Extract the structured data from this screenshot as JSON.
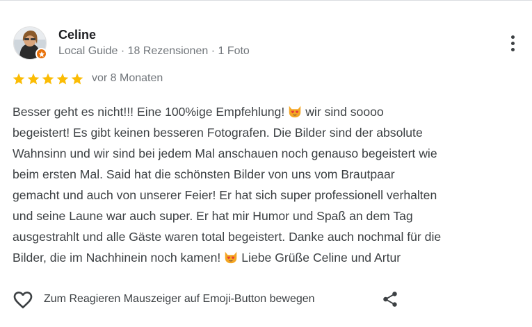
{
  "review": {
    "author": "Celine",
    "author_meta": "Local Guide · 18 Rezensionen · 1 Foto",
    "rating": 5,
    "rating_max": 5,
    "time": "vor 8 Monaten",
    "text_lines": [
      [
        "Besser geht es nicht!!! Eine 100%ige Empfehlung!",
        "wir sind soooo"
      ],
      [
        "begeistert! Es gibt keinen besseren Fotografen. Die Bilder sind der absolute"
      ],
      [
        "Wahnsinn und wir sind bei jedem Mal anschauen noch genauso begeistert wie"
      ],
      [
        "beim ersten Mal. Said hat die schönsten Bilder von uns vom Brautpaar"
      ],
      [
        "gemacht und auch von unserer Feier! Er hat sich super professionell verhalten"
      ],
      [
        "und seine Laune war auch super. Er hat mir Humor und Spaß an dem Tag"
      ],
      [
        "ausgestrahlt und alle Gäste waren total begeistert. Danke auch nochmal für die"
      ],
      [
        "Bilder, die im Nachhinein noch kamen!",
        "Liebe Grüße Celine und Artur"
      ]
    ],
    "emoji": "heart-eyes-cat-emoji"
  },
  "actions": {
    "react_hint": "Zum Reagieren Mauszeiger auf Emoji-Button bewegen"
  },
  "icons": {
    "more": "more-vert-icon",
    "like": "heart-outline-icon",
    "share": "share-icon",
    "badge": "local-guide-star-icon"
  },
  "colors": {
    "star": "#fbbc04",
    "badge": "#e8710a",
    "secondary_text": "#70757a",
    "body_text": "#3c4043",
    "emoji": "#f4a623"
  }
}
